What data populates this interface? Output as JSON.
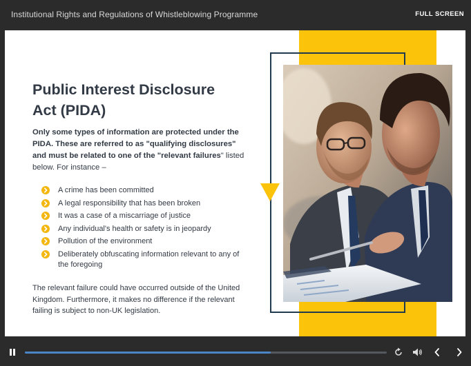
{
  "player": {
    "course_title": "Institutional Rights and Regulations of Whistleblowing Programme",
    "fullscreen_label": "FULL SCREEN",
    "progress": 0.68
  },
  "slide": {
    "heading": "Public Interest Disclosure Act (PIDA)",
    "intro_bold": "Only some types of information are protected under the PIDA. These are referred to as \"qualifying disclosures\" and must be related to one of the \"relevant failures",
    "intro_rest": "\" listed below. For instance –",
    "bullets": [
      "A crime has been committed",
      "A legal responsibility that has been broken",
      "It was a case of a miscarriage of justice",
      "Any individual's health or safety is in jeopardy",
      "Pollution of the environment",
      "Deliberately obfuscating information relevant to any of the foregoing"
    ],
    "closing": "The relevant failure could have occurred outside of the United Kingdom. Furthermore, it makes no difference if the relevant failing is subject to non-UK legislation."
  },
  "icons": {
    "bullet": "chevron-right-icon",
    "pause": "pause-icon",
    "replay": "replay-icon",
    "volume": "volume-icon",
    "prev": "chevron-left-icon",
    "next": "chevron-right-icon"
  },
  "colors": {
    "accent_yellow": "#fcc30b",
    "bullet_yellow": "#f3b70f",
    "frame_navy": "#1f3a4f",
    "heading_text": "#323a45",
    "progress_blue": "#4b86c9",
    "chrome_dark": "#2b2b2b"
  }
}
